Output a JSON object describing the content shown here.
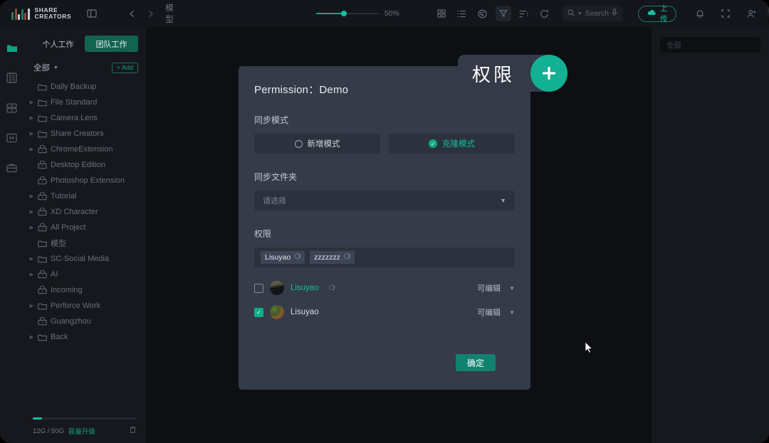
{
  "brand": {
    "line1": "SHARE",
    "line2": "CREATORS"
  },
  "topbar": {
    "breadcrumb": "模型",
    "zoom_value": "50%",
    "search_placeholder": "Search",
    "upload_label": "上传",
    "icons": {
      "panel_toggle": "sidebar-toggle-icon",
      "back": "chevron-left-icon",
      "forward": "chevron-right-icon",
      "grid_view": "grid-view-icon",
      "list_view": "list-view-icon",
      "tag": "tag-icon",
      "filter": "filter-icon",
      "sort": "sort-icon",
      "refresh": "refresh-icon",
      "search": "search-icon",
      "mic": "microphone-icon",
      "cloud": "cloud-upload-icon",
      "bell": "bell-icon",
      "fullscreen": "fullscreen-icon",
      "add_user": "add-user-icon"
    }
  },
  "rail": {
    "items": [
      {
        "name": "assets",
        "icon": "folder-icon",
        "active": true
      },
      {
        "name": "library",
        "icon": "list-panel-icon",
        "active": false
      },
      {
        "name": "archive",
        "icon": "drawer-icon",
        "active": false
      },
      {
        "name": "board",
        "icon": "board-icon",
        "active": false
      },
      {
        "name": "projects",
        "icon": "briefcase-icon",
        "active": false
      }
    ]
  },
  "sidebar": {
    "tabs": [
      {
        "label": "个人工作",
        "active": false
      },
      {
        "label": "团队工作",
        "active": true
      }
    ],
    "all_label": "全部",
    "add_label": "Add",
    "tree": [
      {
        "label": "Daily Backup",
        "icon": "folder-icon",
        "caret": false
      },
      {
        "label": "File Standard",
        "icon": "folder-icon",
        "caret": true
      },
      {
        "label": "Camera Lens",
        "icon": "folder-icon",
        "caret": true
      },
      {
        "label": "Share Creators",
        "icon": "folder-icon",
        "caret": true
      },
      {
        "label": "ChromeExtension",
        "icon": "locked-folder-icon",
        "caret": true
      },
      {
        "label": "Desktop Edition",
        "icon": "locked-folder-icon",
        "caret": false
      },
      {
        "label": "Photoshop Extension",
        "icon": "locked-folder-icon",
        "caret": false
      },
      {
        "label": "Tutorial",
        "icon": "locked-folder-icon",
        "caret": true
      },
      {
        "label": "XD Character",
        "icon": "locked-folder-icon",
        "caret": true
      },
      {
        "label": "All Project",
        "icon": "locked-folder-icon",
        "caret": true
      },
      {
        "label": "模型",
        "icon": "folder-icon",
        "caret": false
      },
      {
        "label": "SC-Social Media",
        "icon": "folder-icon",
        "caret": true
      },
      {
        "label": "AI",
        "icon": "locked-folder-icon",
        "caret": true
      },
      {
        "label": "Incoming",
        "icon": "locked-folder-icon",
        "caret": false
      },
      {
        "label": "Perforce Work",
        "icon": "folder-icon",
        "caret": true
      },
      {
        "label": "Guangzhou",
        "icon": "locked-folder-icon",
        "caret": false
      },
      {
        "label": "Back",
        "icon": "folder-icon",
        "caret": true
      }
    ],
    "storage": {
      "text": "12G / 50G",
      "upgrade_label": "容量升级",
      "used_percent": 9,
      "trash_icon": "trash-icon"
    }
  },
  "right_panel": {
    "search_placeholder": "全部"
  },
  "modal": {
    "title": "Permission：Demo",
    "sync_mode_label": "同步模式",
    "modes": [
      {
        "label": "新增模式",
        "selected": false
      },
      {
        "label": "克隆模式",
        "selected": true
      }
    ],
    "sync_folder_label": "同步文件夹",
    "folder_placeholder": "请选择",
    "permission_label": "权限",
    "tags": [
      "Lisuyao",
      "zzzzzzz"
    ],
    "users": [
      {
        "name": "Lisuyao",
        "checked": false,
        "highlight": true,
        "removable": true,
        "permission": "可编辑"
      },
      {
        "name": "Lisuyao",
        "checked": true,
        "highlight": false,
        "removable": false,
        "permission": "可编辑"
      }
    ],
    "confirm_label": "确定"
  },
  "callout": {
    "text": "权限",
    "plus_icon": "plus-icon"
  },
  "colors": {
    "accent": "#12bfa0",
    "accent_dark": "#128270",
    "modal_bg": "#353b49",
    "app_bg": "#0d0f13"
  }
}
